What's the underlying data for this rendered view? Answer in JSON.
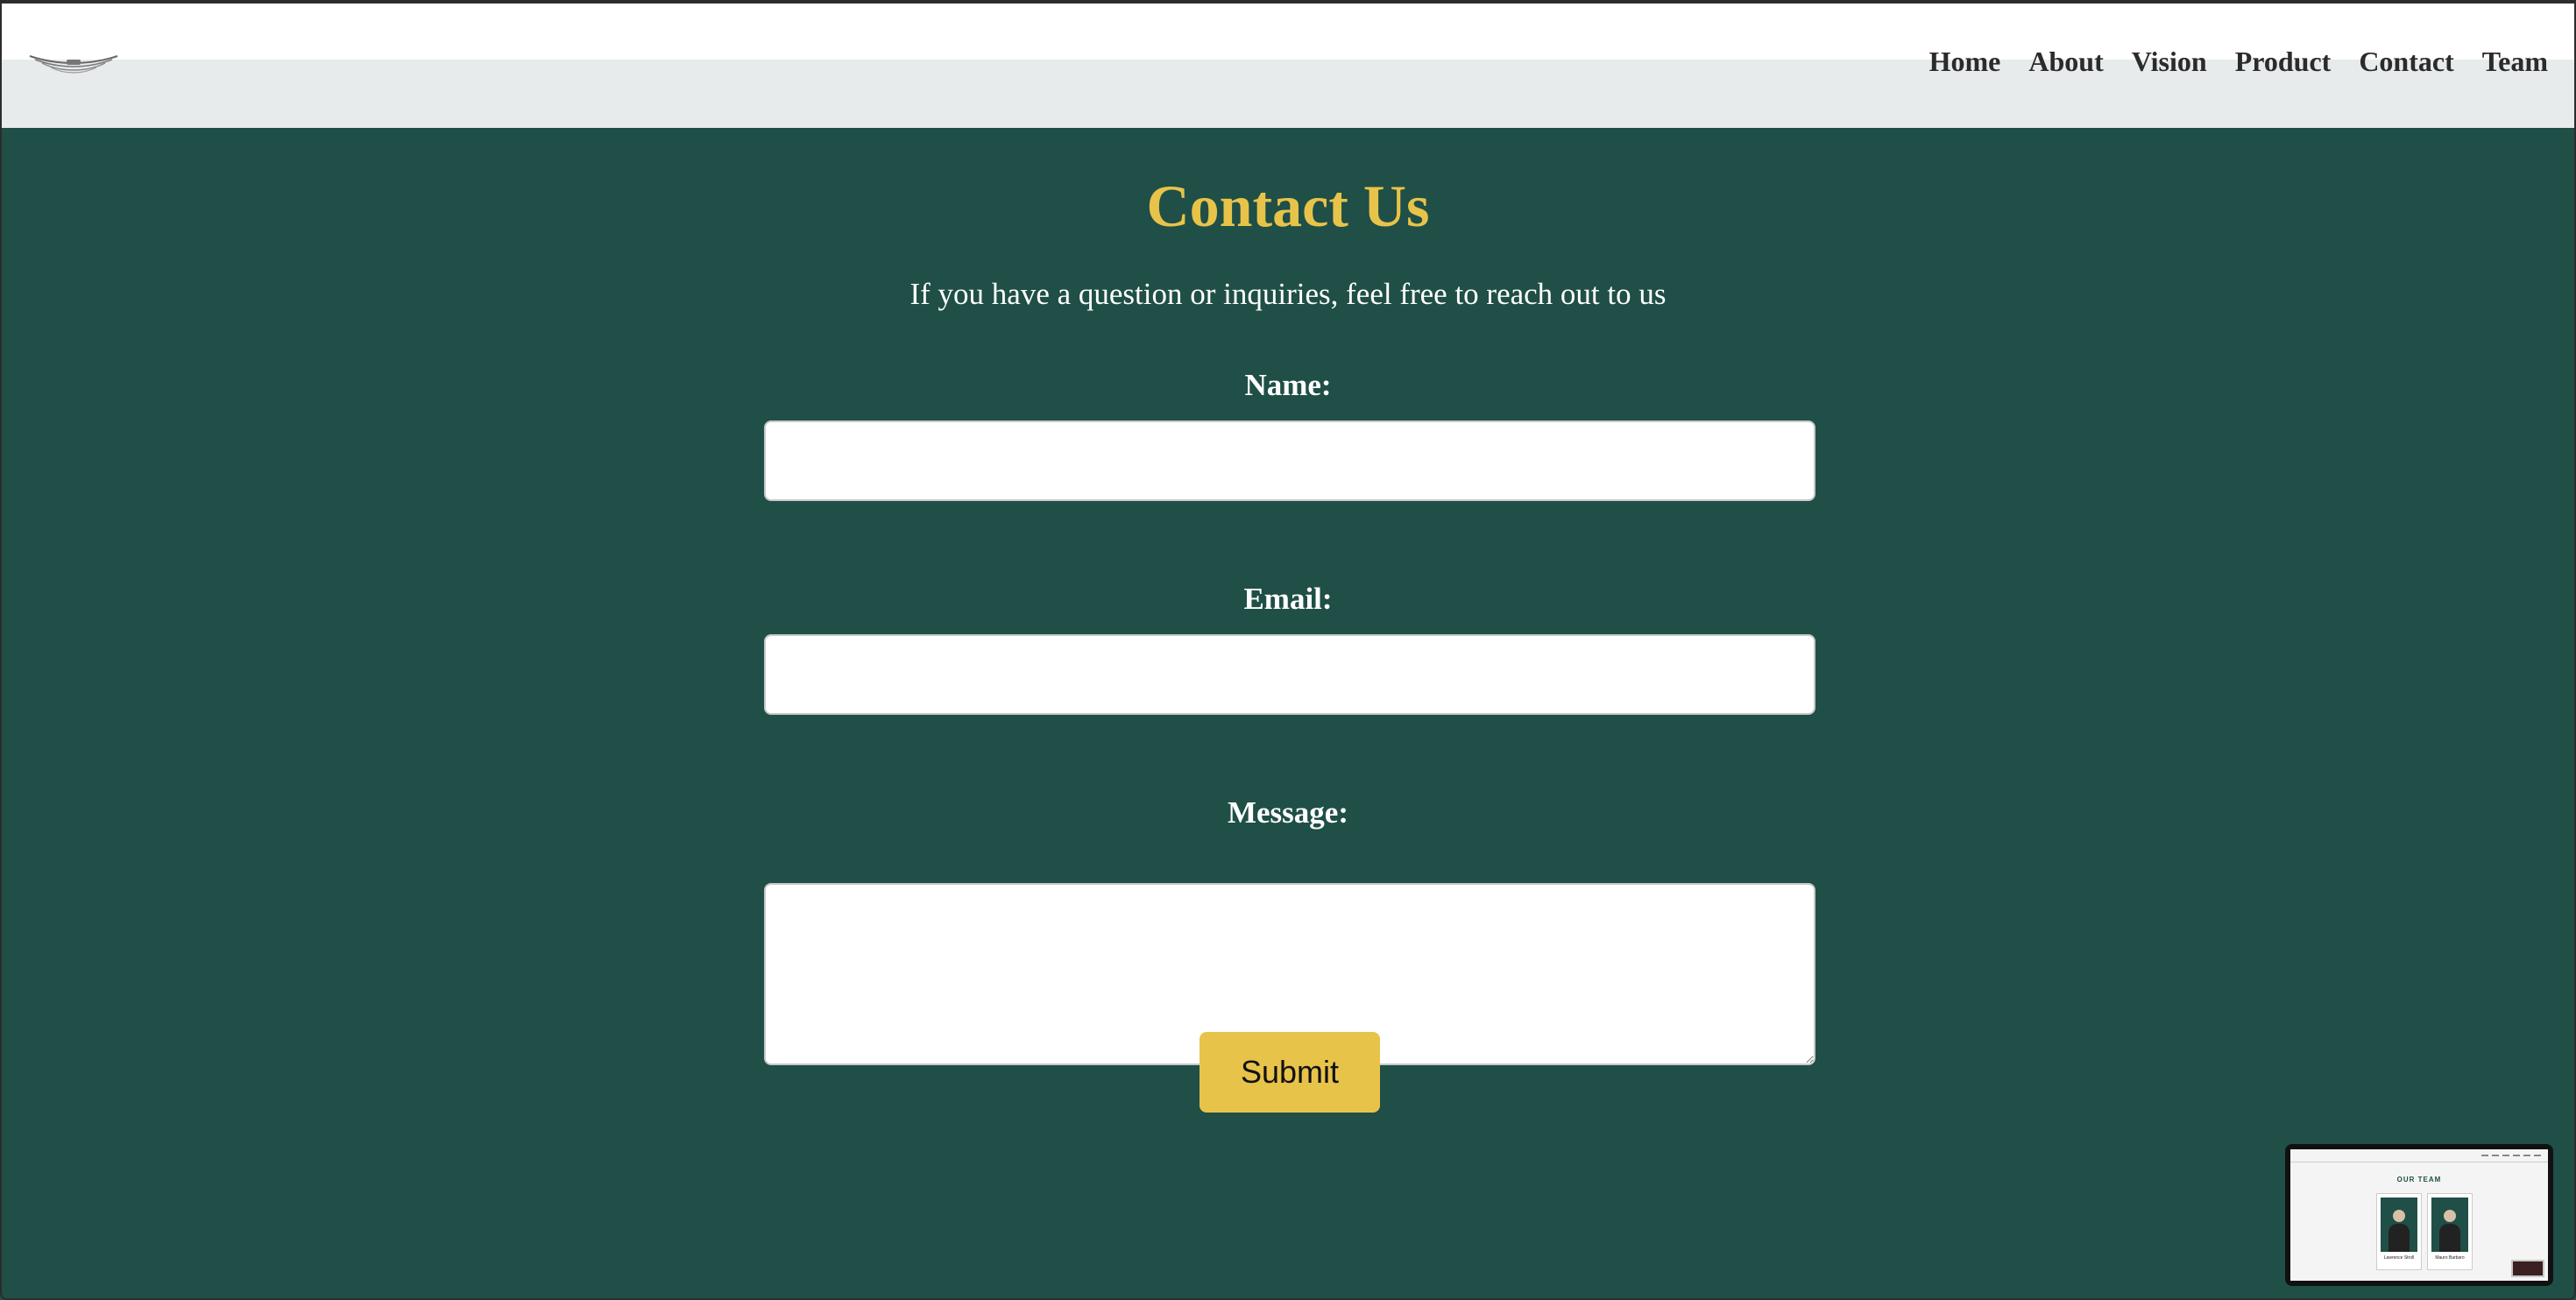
{
  "nav": {
    "items": [
      "Home",
      "About",
      "Vision",
      "Product",
      "Contact",
      "Team"
    ]
  },
  "main": {
    "title": "Contact Us",
    "subtitle": "If you have a question or inquiries, feel free to reach out to us"
  },
  "form": {
    "name_label": "Name:",
    "name_value": "",
    "email_label": "Email:",
    "email_value": "",
    "message_label": "Message:",
    "message_value": "",
    "submit_label": "Submit"
  },
  "thumbnail": {
    "title": "OUR TEAM",
    "cards": [
      "Lawrence Stroll",
      "Mauro Barbaro"
    ]
  },
  "colors": {
    "background": "#1f4f47",
    "accent": "#e8c34a",
    "header": "#e7ebeb"
  },
  "icons": {
    "logo": "winged-logo-icon"
  }
}
